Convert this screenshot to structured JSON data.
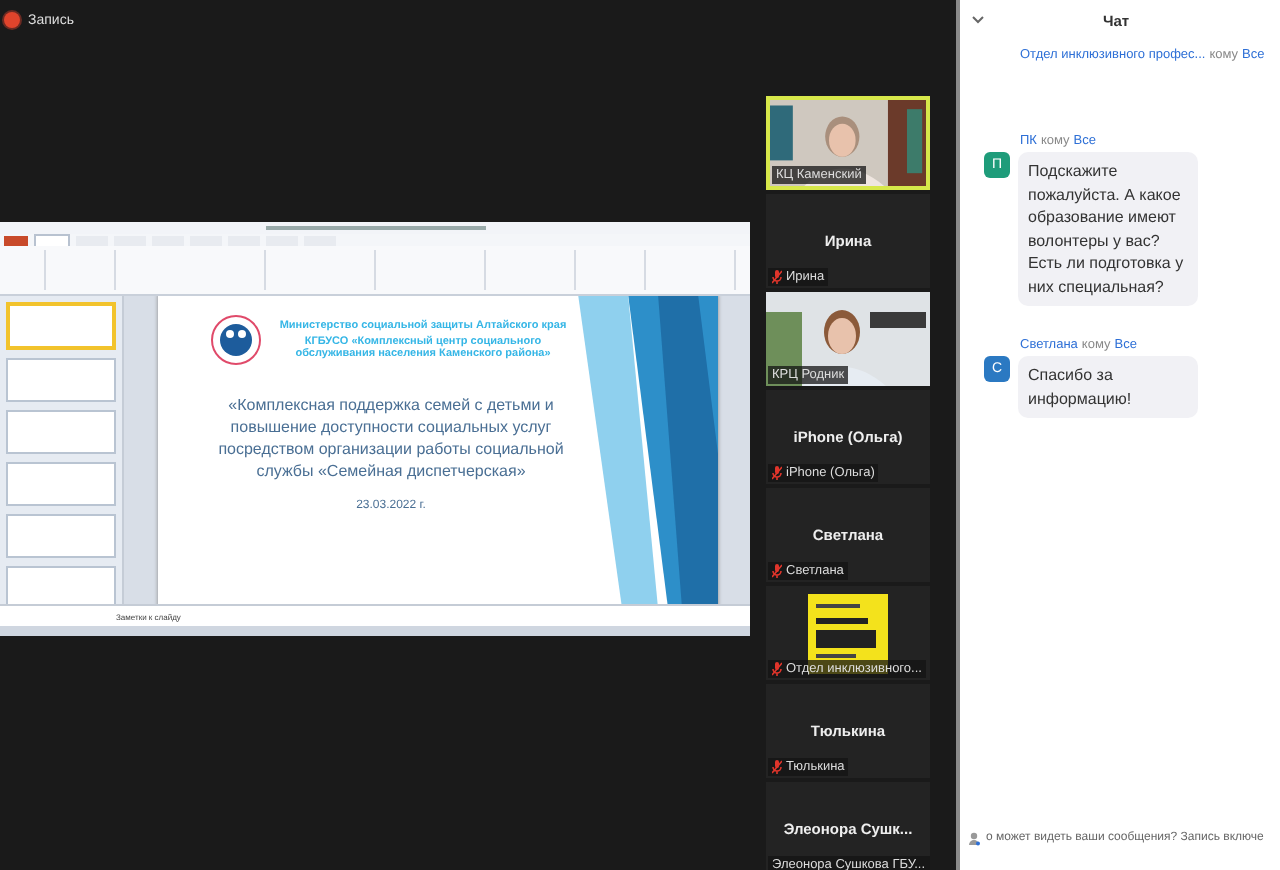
{
  "recording": {
    "label": "Запись"
  },
  "shared_screen": {
    "ribbon_tabs": [
      {
        "selected": false
      },
      {
        "selected": true
      },
      {
        "selected": false
      },
      {
        "selected": false
      },
      {
        "selected": false
      },
      {
        "selected": false
      },
      {
        "selected": false
      },
      {
        "selected": false
      },
      {
        "selected": false
      }
    ],
    "thumbnails": [
      {
        "selected": true
      },
      {
        "selected": false
      },
      {
        "selected": false
      },
      {
        "selected": false
      },
      {
        "selected": false
      },
      {
        "selected": false
      }
    ],
    "slide": {
      "ministry": "Министерство социальной защиты Алтайского края",
      "org": "КГБУСО «Комплексный центр социального обслуживания населения Каменского района»",
      "title": "«Комплексная поддержка семей с детьми и повышение доступности социальных услуг посредством организации работы социальной службы «Семейная диспетчерская»",
      "date": "23.03.2022 г."
    },
    "notes_placeholder": "Заметки к слайду"
  },
  "participants": [
    {
      "kind": "video",
      "name": "КЦ Каменский",
      "muted": false,
      "speaking": true
    },
    {
      "kind": "name",
      "display": "Ирина",
      "name": "Ирина",
      "muted": true,
      "speaking": false
    },
    {
      "kind": "video",
      "name": "КРЦ Родник",
      "muted": false,
      "speaking": false
    },
    {
      "kind": "name",
      "display": "iPhone (Ольга)",
      "name": "iPhone (Ольга)",
      "muted": true,
      "speaking": false
    },
    {
      "kind": "name",
      "display": "Светлана",
      "name": "Светлана",
      "muted": true,
      "speaking": false
    },
    {
      "kind": "logo",
      "name": "Отдел инклюзивного...",
      "muted": true,
      "speaking": false
    },
    {
      "kind": "name",
      "display": "Тюлькина",
      "name": "Тюлькина",
      "muted": true,
      "speaking": false
    },
    {
      "kind": "name",
      "display": "Элеонора  Сушк...",
      "name": "Элеонора Сушкова ГБУ...",
      "muted": false,
      "speaking": false
    }
  ],
  "chat": {
    "title": "Чат",
    "messages": [
      {
        "sender": "Отдел инклюзивного профес...",
        "to_label": "кому",
        "to": "Все"
      },
      {
        "sender": "ПК",
        "to_label": "кому",
        "to": "Все",
        "avatar": "П",
        "color": "#1e9c7a",
        "text": "Подскажите пожалуйста. А какое образование имеют волонтеры у вас? Есть ли подготовка у них специальная?"
      },
      {
        "sender": "Светлана",
        "to_label": "кому",
        "to": "Все",
        "avatar": "С",
        "color": "#2b79c2",
        "text": "Спасибо за информацию!"
      }
    ],
    "footer": "о может видеть ваши сообщения? Запись включе"
  }
}
